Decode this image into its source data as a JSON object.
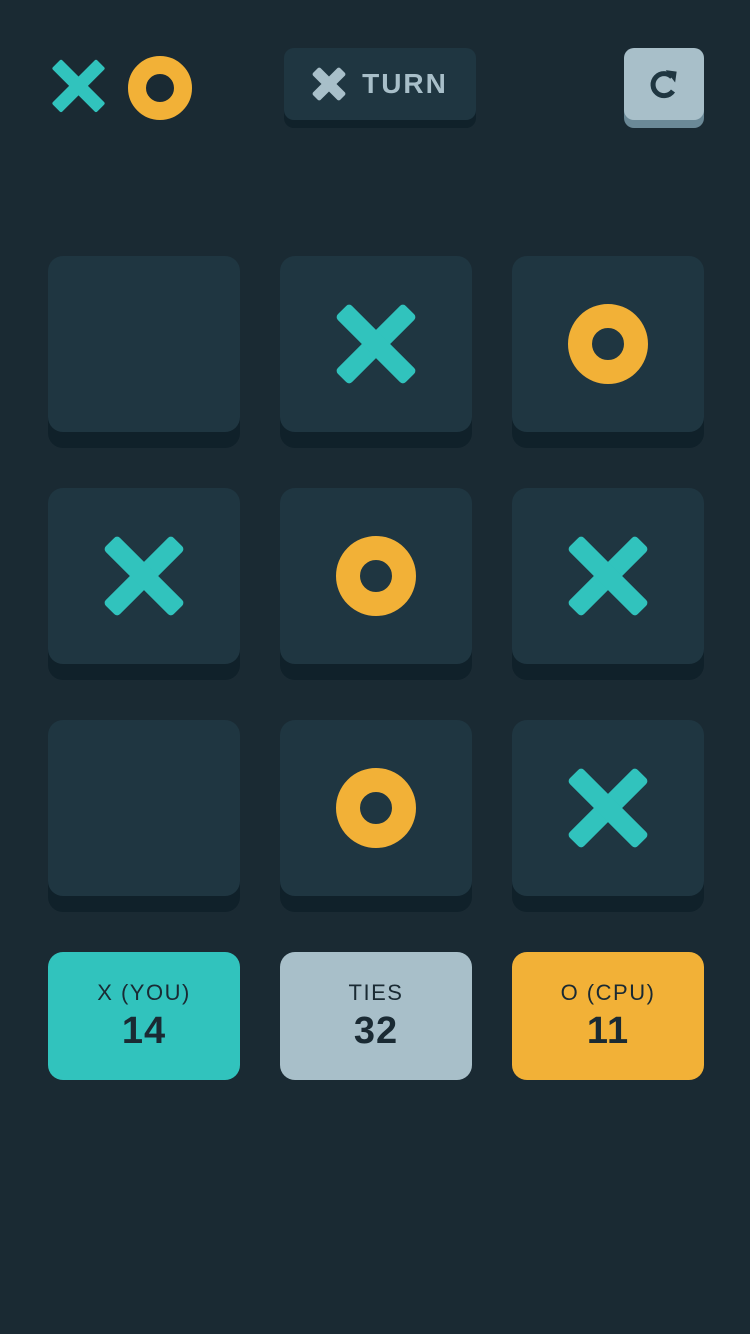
{
  "colors": {
    "background": "#1a2a33",
    "cell": "#1f3641",
    "x_mark": "#31c3bd",
    "o_mark": "#f2b137",
    "silver": "#a8bfc9"
  },
  "header": {
    "logo_icons": [
      "x-mark-icon",
      "o-mark-icon"
    ],
    "turn_indicator": {
      "mark": "X",
      "label": "TURN"
    },
    "restart_button": {
      "icon": "restart-icon"
    }
  },
  "board": {
    "cells": [
      "",
      "X",
      "O",
      "X",
      "O",
      "X",
      "",
      "O",
      "X"
    ]
  },
  "scores": [
    {
      "label": "X (YOU)",
      "value": "14",
      "color": "#31c3bd"
    },
    {
      "label": "TIES",
      "value": "32",
      "color": "#a8bfc9"
    },
    {
      "label": "O (CPU)",
      "value": "11",
      "color": "#f2b137"
    }
  ]
}
